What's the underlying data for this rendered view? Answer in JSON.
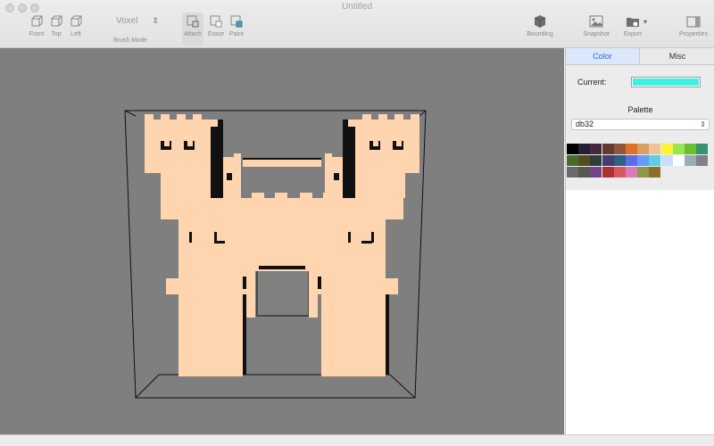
{
  "window": {
    "title": "Untitled"
  },
  "toolbar": {
    "view_buttons": [
      {
        "id": "front",
        "label": "Front"
      },
      {
        "id": "top",
        "label": "Top"
      },
      {
        "id": "left",
        "label": "Left"
      }
    ],
    "brush_mode": {
      "value": "Voxel",
      "label": "Brush Mode"
    },
    "brush_buttons": [
      {
        "id": "attach",
        "label": "Attach",
        "active": true
      },
      {
        "id": "erase",
        "label": "Erase",
        "active": false
      },
      {
        "id": "paint",
        "label": "Paint",
        "active": false
      }
    ],
    "bounding_label": "Bounding",
    "snapshot_label": "Snapshot",
    "export_label": "Export",
    "properties_label": "Properties"
  },
  "panel": {
    "tabs": [
      {
        "id": "color",
        "label": "Color",
        "selected": true
      },
      {
        "id": "misc",
        "label": "Misc",
        "selected": false
      }
    ],
    "current_label": "Current:",
    "current_color": "#3ef0e0",
    "palette_label": "Palette",
    "palette_value": "db32",
    "palette_colors": [
      "#000000",
      "#222034",
      "#45283c",
      "#663931",
      "#8f563b",
      "#df7126",
      "#d9a066",
      "#eec39a",
      "#fbf236",
      "#99e550",
      "#6abe30",
      "#37946e",
      "#4b692f",
      "#524b24",
      "#323c39",
      "#3f3f74",
      "#306082",
      "#5b6ee1",
      "#639bff",
      "#5fcde4",
      "#cbdbfc",
      "#ffffff",
      "#9badb7",
      "#847e87",
      "#696a6a",
      "#595652",
      "#76428a",
      "#ac3232",
      "#d95763",
      "#d77bba",
      "#8f974a",
      "#8a6f30"
    ]
  },
  "scene": {
    "model_color": "#fed5ae",
    "background_color": "#7f7f7f"
  }
}
